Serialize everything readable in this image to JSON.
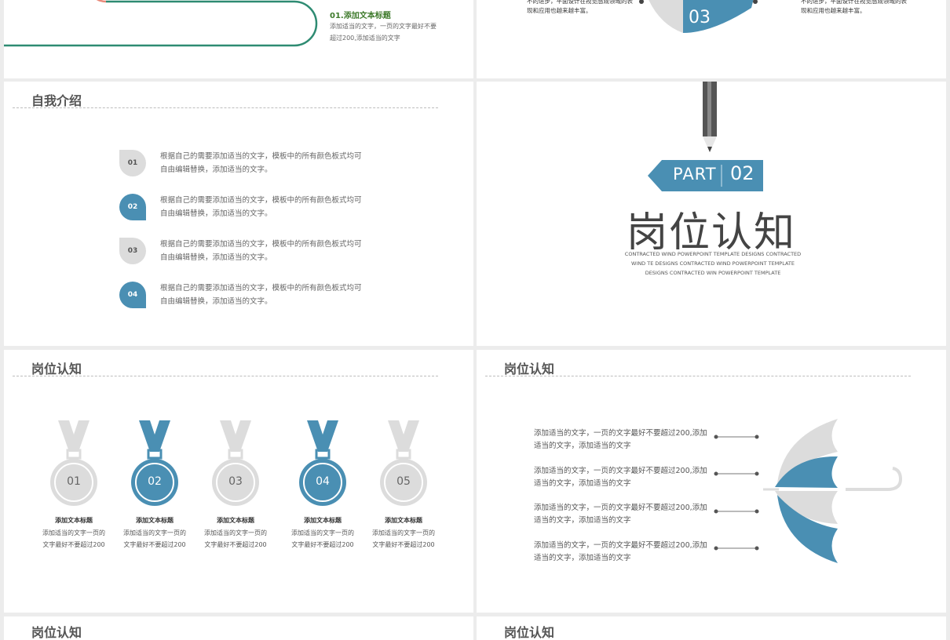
{
  "slide_top_left": {
    "title": "01.添加文本标题",
    "text": "添加适当的文字，一页的文字最好不要超过200,添加适当的文字"
  },
  "slide_top_right": {
    "left_text": "不的进步，平面设计在视觉感观领域的表现和应用也越来越丰富。",
    "right_text": "不的进步，平面设计在视觉感观领域的表现和应用也越来越丰富。",
    "circle_number": "03"
  },
  "intro": {
    "title": "自我介绍",
    "items": [
      {
        "num": "01",
        "text": "根据自己的需要添加适当的文字，模板中的所有颜色板式均可自由编辑替换，添加适当的文字。"
      },
      {
        "num": "02",
        "text": "根据自己的需要添加适当的文字，模板中的所有颜色板式均可自由编辑替换，添加适当的文字。"
      },
      {
        "num": "03",
        "text": "根据自己的需要添加适当的文字，模板中的所有颜色板式均可自由编辑替换，添加适当的文字。"
      },
      {
        "num": "04",
        "text": "根据自己的需要添加适当的文字，模板中的所有颜色板式均可自由编辑替换，添加适当的文字。"
      }
    ]
  },
  "part": {
    "label": "PART",
    "number": "02",
    "title": "岗位认知",
    "english": "CONTRACTED WIND POWERPOINT TEMPLATE DESIGNS CONTRACTED WIND TE DESIGNS CONTRACTED WIND POWERPOINT TEMPLATE DESIGNS CONTRACTED WIN POWERPOINT TEMPLATE"
  },
  "medals": {
    "title": "岗位认知",
    "items": [
      {
        "num": "01",
        "title": "添加文本标题",
        "desc": "添加适当的文字一页的文字最好不要超过200"
      },
      {
        "num": "02",
        "title": "添加文本标题",
        "desc": "添加适当的文字一页的文字最好不要超过200"
      },
      {
        "num": "03",
        "title": "添加文本标题",
        "desc": "添加适当的文字一页的文字最好不要超过200"
      },
      {
        "num": "04",
        "title": "添加文本标题",
        "desc": "添加适当的文字一页的文字最好不要超过200"
      },
      {
        "num": "05",
        "title": "添加文本标题",
        "desc": "添加适当的文字一页的文字最好不要超过200"
      }
    ]
  },
  "umbrella": {
    "title": "岗位认知",
    "items": [
      "添加适当的文字，一页的文字最好不要超过200,添加适当的文字，添加适当的文字",
      "添加适当的文字，一页的文字最好不要超过200,添加适当的文字，添加适当的文字",
      "添加适当的文字，一页的文字最好不要超过200,添加适当的文字，添加适当的文字",
      "添加适当的文字，一页的文字最好不要超过200,添加适当的文字，添加适当的文字"
    ]
  },
  "bottom": {
    "left_title": "岗位认知",
    "right_title": "岗位认知"
  },
  "colors": {
    "blue": "#4a8fb3",
    "gray": "#dcdcdc",
    "green": "#2e8b72",
    "coral": "#e9897a"
  }
}
